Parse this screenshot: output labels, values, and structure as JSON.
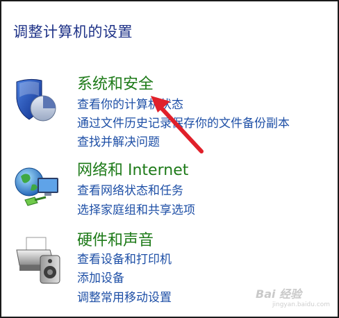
{
  "page": {
    "title": "调整计算机的设置"
  },
  "categories": [
    {
      "icon": "shield-icon",
      "title": "系统和安全",
      "links": [
        "查看你的计算机状态",
        "通过文件历史记录保存你的文件备份副本",
        "查找并解决问题"
      ]
    },
    {
      "icon": "network-icon",
      "title": "网络和 Internet",
      "links": [
        "查看网络状态和任务",
        "选择家庭组和共享选项"
      ]
    },
    {
      "icon": "printer-icon",
      "title": "硬件和声音",
      "links": [
        "查看设备和打印机",
        "添加设备",
        "调整常用移动设置"
      ]
    }
  ],
  "annotation": {
    "arrow_color": "#e0202a"
  },
  "watermark": {
    "text": "Bai 经验",
    "sub": "jingyan.baidu.com"
  }
}
